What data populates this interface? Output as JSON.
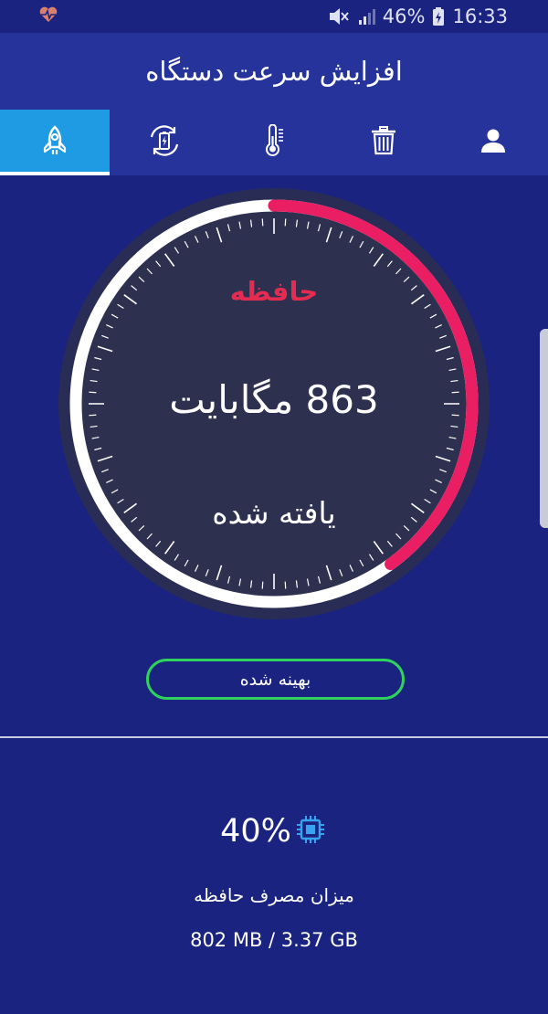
{
  "status_bar": {
    "battery_percent": "46%",
    "time": "16:33",
    "left_icon": "heart-pulse-icon",
    "icons": [
      "mute-icon",
      "signal-icon",
      "battery-charging-icon"
    ]
  },
  "app_bar": {
    "title": "افزایش سرعت دستگاه"
  },
  "tabs": [
    {
      "icon": "rocket-icon",
      "active": true
    },
    {
      "icon": "battery-refresh-icon",
      "active": false
    },
    {
      "icon": "thermometer-icon",
      "active": false
    },
    {
      "icon": "trash-icon",
      "active": false
    },
    {
      "icon": "user-icon",
      "active": false
    }
  ],
  "gauge": {
    "title": "حافظه",
    "value": "863 مگابایت",
    "status": "یافته شده",
    "progress_fraction": 0.4,
    "colors": {
      "track": "#ffffff",
      "progress": "#e91e63",
      "disc": "#2e3050",
      "ring": "#292d55"
    }
  },
  "optimize_button": {
    "label": "بهینه شده",
    "border_color": "#2fd35b"
  },
  "memory_usage": {
    "percent": "40%",
    "icon": "cpu-chip-icon",
    "label": "میزان مصرف حافظه",
    "detail": "802 MB / 3.37 GB"
  }
}
